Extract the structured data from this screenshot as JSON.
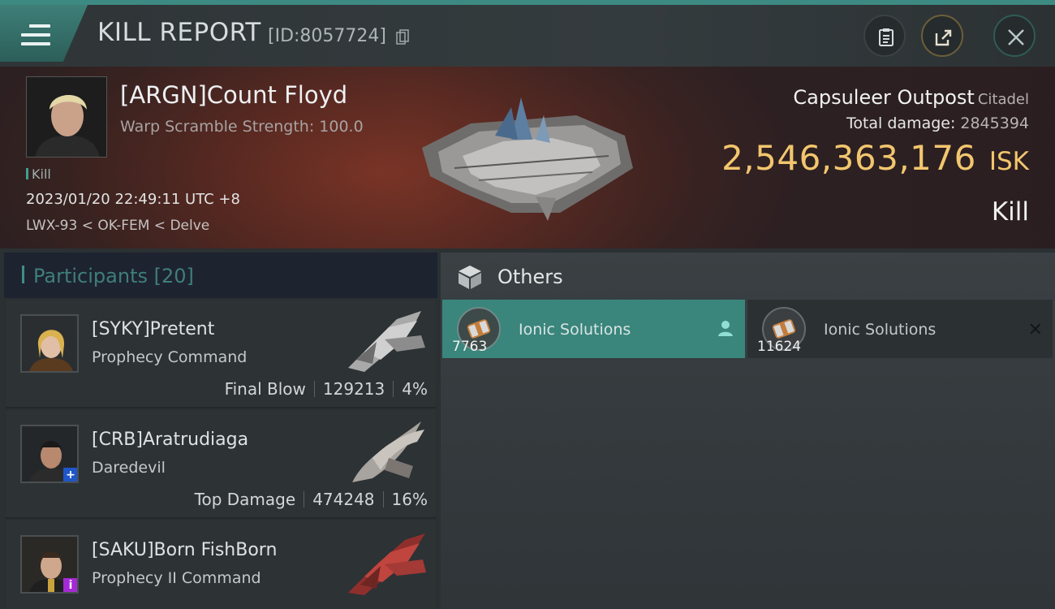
{
  "header": {
    "title": "KILL REPORT",
    "kill_id": "[ID:8057724]"
  },
  "victim": {
    "pilot": "[ARGN]Count Floyd",
    "scramble": "Warp Scramble Strength: 100.0",
    "tag": "Kill",
    "datetime": "2023/01/20 22:49:11 UTC +8",
    "location": "LWX-93 < OK-FEM < Delve",
    "ship": "Capsuleer Outpost",
    "ship_class": "Citadel",
    "total_damage_label": "Total damage:",
    "total_damage": "2845394",
    "isk_value": "2,546,363,176",
    "isk_unit": "ISK",
    "result": "Kill"
  },
  "participants": {
    "label": "Participants",
    "count": "[20]",
    "items": [
      {
        "name": "[SYKY]Pretent",
        "ship": "Prophecy Command",
        "role": "Final Blow",
        "damage": "129213",
        "percent": "4%"
      },
      {
        "name": "[CRB]Aratrudiaga",
        "ship": "Daredevil",
        "role": "Top Damage",
        "damage": "474248",
        "percent": "16%"
      },
      {
        "name": "[SAKU]Born FishBorn",
        "ship": "Prophecy II Command"
      }
    ]
  },
  "others": {
    "label": "Others",
    "items": [
      {
        "name": "Ionic Solutions",
        "qty": "7763"
      },
      {
        "name": "Ionic Solutions",
        "qty": "11624"
      }
    ]
  },
  "colors": {
    "accent": "#3a857c",
    "isk": "#f2c66e",
    "header_bar": "#3d8a82"
  }
}
